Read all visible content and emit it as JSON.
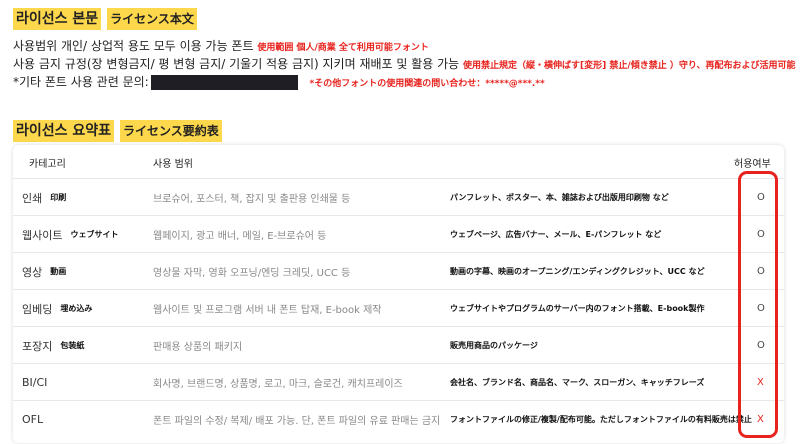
{
  "license_body": {
    "title_ko": "라이선스 본문",
    "title_ja": "ライセンス本文",
    "line1_ko": "사용범위 개인/ 상업적 용도 모두 이용 가능 폰트",
    "line1_ja": "使用範囲 個人/商業 全て利用可能フォント",
    "line2_ko": "사용 금지 규정(장 변형금지/ 평 변형 금지/ 기울기 적용 금지) 지키며 재배포 및 활용 가능",
    "line2_ja": "使用禁止規定（縦・横伸ばす[変形] 禁止/傾き禁止 ）守り、再配布および活用可能",
    "line3_ko": "*기타 폰트 사용 관련 문의:",
    "line3_ja": "*その他フォントの使用関連の問い合わせ：*****@***.**"
  },
  "summary": {
    "title_ko": "라이선스 요약표",
    "title_ja": "ライセンス要約表",
    "headers": {
      "category": "카테고리",
      "scope": "사용 범위",
      "allowed": "허용여부"
    },
    "rows": [
      {
        "cat_ko": "인쇄",
        "cat_ja": "印刷",
        "use_ko": "브로슈어, 포스터, 책, 잡지 및 출판용 인쇄물 등",
        "use_ja": "パンフレット、ポスター、本、雑誌および出版用印刷物 など",
        "allowed": "O"
      },
      {
        "cat_ko": "웹사이트",
        "cat_ja": "ウェブサイト",
        "use_ko": "웹페이지, 광고 배너, 메일, E-브로슈어 등",
        "use_ja": "ウェブページ、広告バナー、メール、E-パンフレット など",
        "allowed": "O"
      },
      {
        "cat_ko": "영상",
        "cat_ja": "動画",
        "use_ko": "영상물 자막, 영화 오프닝/엔딩 크레딧, UCC 등",
        "use_ja": "動画の字幕、映画のオープニング/エンディングクレジット、UCC など",
        "allowed": "O"
      },
      {
        "cat_ko": "임베딩",
        "cat_ja": "埋め込み",
        "use_ko": "웹사이트 및 프로그램 서버 내 폰트 탑재, E-book 제작",
        "use_ja": "ウェブサイトやプログラムのサーバー内のフォント搭載、E-book製作",
        "allowed": "O"
      },
      {
        "cat_ko": "포장지",
        "cat_ja": "包装紙",
        "use_ko": "판매용 상품의 패키지",
        "use_ja": "販売用商品のパッケージ",
        "allowed": "O"
      },
      {
        "cat_ko": "BI/CI",
        "cat_ja": "",
        "use_ko": "회사명, 브랜드명, 상품명, 로고, 마크, 슬로건, 캐치프레이즈",
        "use_ja": "会社名、ブランド名、商品名、マーク、スローガン、キャッチフレーズ",
        "allowed": "X"
      },
      {
        "cat_ko": "OFL",
        "cat_ja": "",
        "use_ko": "폰트 파일의 수정/ 복제/ 배포 가능. 단, 폰트 파일의 유료 판매는 금지",
        "use_ja": "フォントファイルの修正/複製/配布可能。ただしフォントファイルの有料販売は禁止",
        "allowed": "X"
      }
    ]
  },
  "colors": {
    "highlight": "#fdd74c",
    "red": "#e8231e"
  }
}
